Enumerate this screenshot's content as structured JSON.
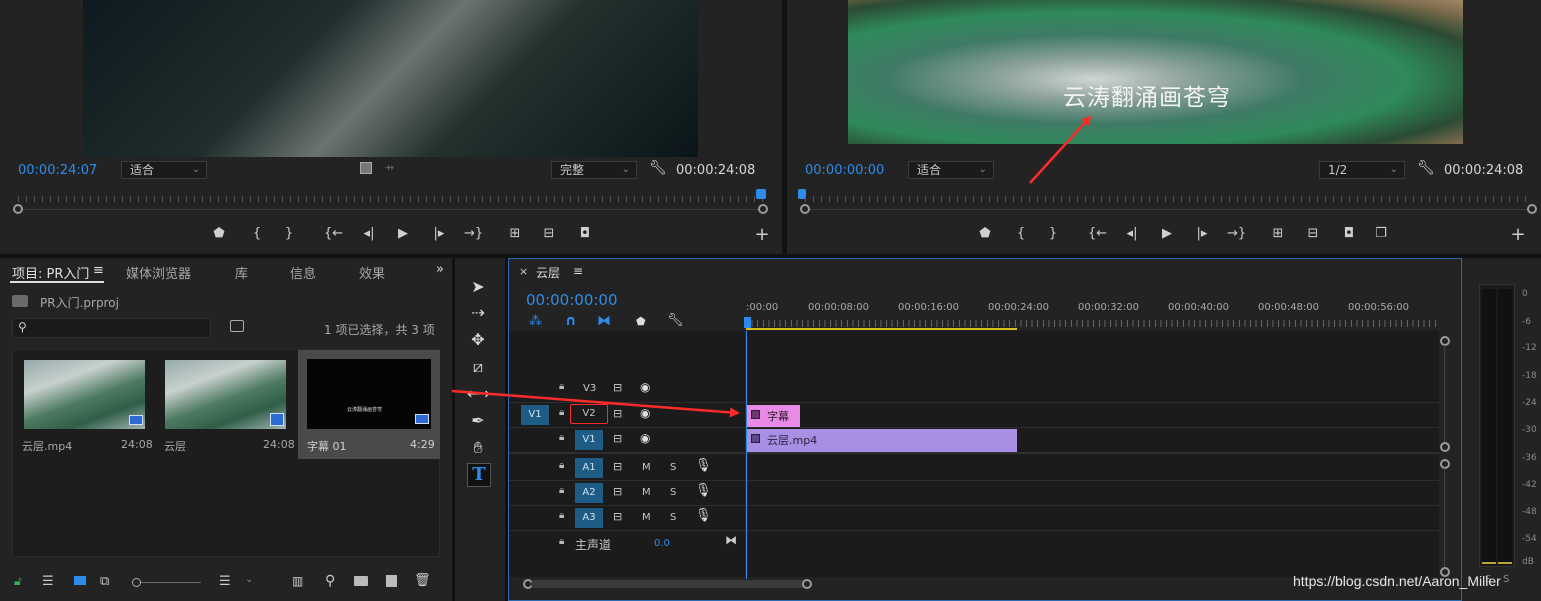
{
  "source_monitor": {
    "timecode_current": "00:00:24:07",
    "zoom": "适合",
    "quality": "完整",
    "timecode_duration": "00:00:24:08"
  },
  "program_monitor": {
    "overlay_text": "云涛翻涌画苍穹",
    "timecode_current": "00:00:00:00",
    "zoom": "适合",
    "quality": "1/2",
    "timecode_duration": "00:00:24:08"
  },
  "project_panel": {
    "tabs": [
      "项目: PR入门",
      "媒体浏览器",
      "库",
      "信息",
      "效果"
    ],
    "project_file": "PR入门.prproj",
    "search_placeholder": "",
    "selection_status": "1 项已选择，共 3 项",
    "items": [
      {
        "name": "云层.mp4",
        "duration": "24:08"
      },
      {
        "name": "云层",
        "duration": "24:08"
      },
      {
        "name": "字幕 01",
        "duration": "4:29"
      }
    ]
  },
  "timeline": {
    "sequence_name": "云层",
    "timecode": "00:00:00:00",
    "ruler": [
      ":00:00",
      "00:00:08:00",
      "00:00:16:00",
      "00:00:24:00",
      "00:00:32:00",
      "00:00:40:00",
      "00:00:48:00",
      "00:00:56:00"
    ],
    "video_tracks": [
      "V3",
      "V2",
      "V1"
    ],
    "source_patch": "V1",
    "audio_tracks": [
      "A1",
      "A2",
      "A3"
    ],
    "master_label": "主声道",
    "master_value": "0.0",
    "audio_btn_m": "M",
    "audio_btn_s": "S",
    "clips": [
      {
        "track": "V2",
        "name": "字幕",
        "color": "#e88ae6"
      },
      {
        "track": "V1",
        "name": "云层.mp4",
        "color": "#a88fe4"
      }
    ]
  },
  "audio_meter": {
    "db_labels": [
      "0",
      "-6",
      "-12",
      "-18",
      "-24",
      "-30",
      "-36",
      "-42",
      "-48",
      "-54",
      "dB"
    ],
    "solo_labels": [
      "S",
      "S"
    ]
  },
  "watermark": "https://blog.csdn.net/Aaron_Miller",
  "colors": {
    "accent_blue": "#2d8ceb",
    "track_blue": "#1f5c85",
    "clip_pink": "#e88ae6",
    "clip_purple": "#a88fe4",
    "arrow_red": "#ff2a2a"
  }
}
